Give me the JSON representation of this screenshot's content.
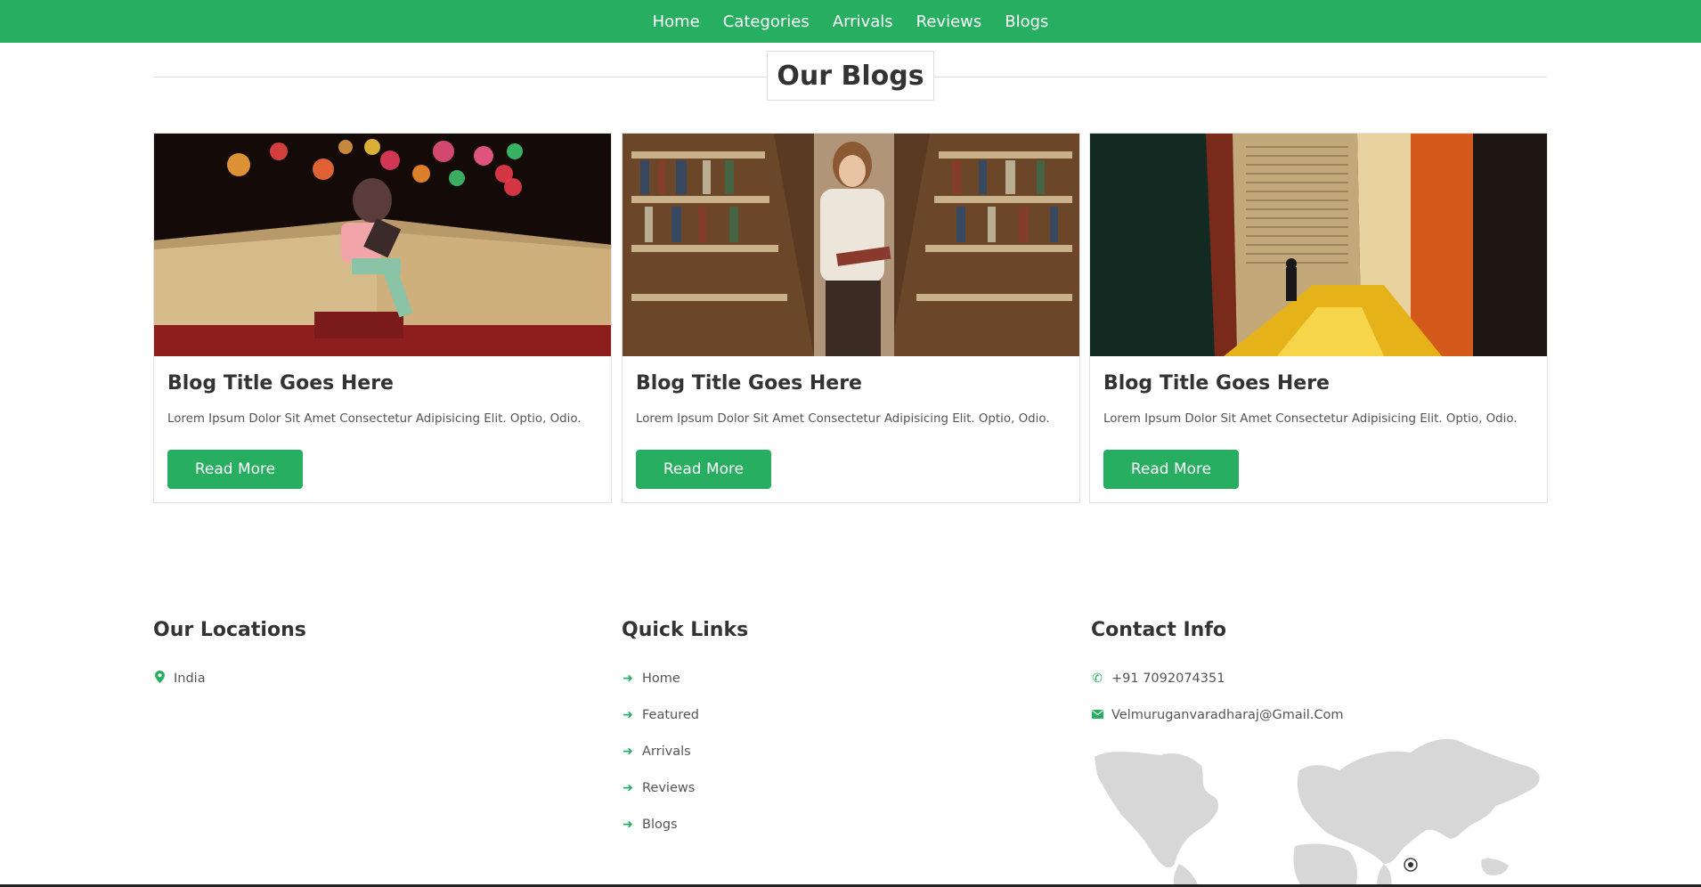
{
  "nav": {
    "items": [
      "Home",
      "Categories",
      "Arrivals",
      "Reviews",
      "Blogs"
    ]
  },
  "section": {
    "title": "Our Blogs"
  },
  "blogs": [
    {
      "title": "Blog Title Goes Here",
      "text": "Lorem Ipsum Dolor Sit Amet Consectetur Adipisicing Elit. Optio, Odio.",
      "button": "Read More"
    },
    {
      "title": "Blog Title Goes Here",
      "text": "Lorem Ipsum Dolor Sit Amet Consectetur Adipisicing Elit. Optio, Odio.",
      "button": "Read More"
    },
    {
      "title": "Blog Title Goes Here",
      "text": "Lorem Ipsum Dolor Sit Amet Consectetur Adipisicing Elit. Optio, Odio.",
      "button": "Read More"
    }
  ],
  "footer": {
    "locations": {
      "title": "Our Locations",
      "items": [
        "India"
      ]
    },
    "quick_links": {
      "title": "Quick Links",
      "items": [
        "Home",
        "Featured",
        "Arrivals",
        "Reviews",
        "Blogs"
      ]
    },
    "contact": {
      "title": "Contact Info",
      "phone": "+91 7092074351",
      "email": "Velmuruganvaradharaj@Gmail.Com"
    }
  },
  "colors": {
    "accent": "#27ae60",
    "text": "#333333",
    "border": "#e0e0e0"
  },
  "icons": {
    "location": "map-marker-icon",
    "link": "arrow-right-icon",
    "phone": "phone-icon",
    "email": "envelope-icon"
  }
}
